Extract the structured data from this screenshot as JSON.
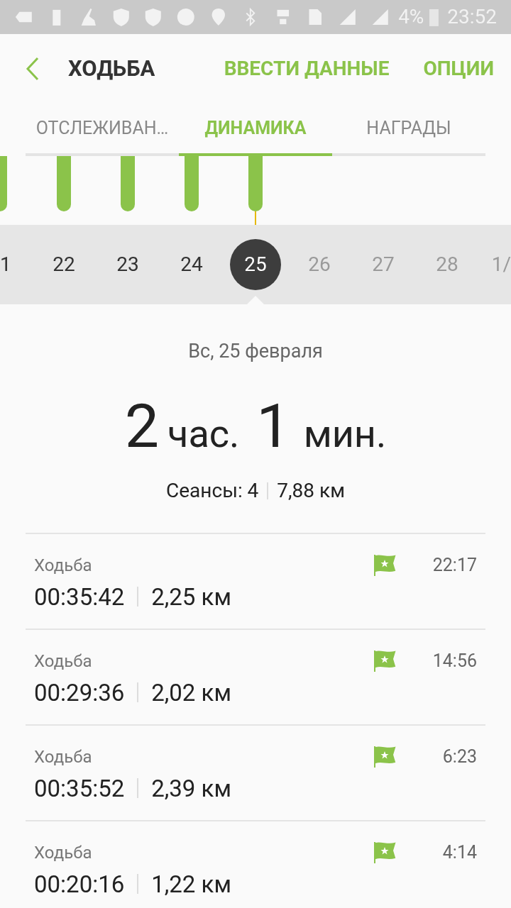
{
  "status_bar": {
    "battery": "4%",
    "time": "23:52"
  },
  "header": {
    "title": "ХОДЬБА",
    "actions": [
      "ВВЕСТИ ДАННЫЕ",
      "ОПЦИИ"
    ]
  },
  "tabs": [
    {
      "label": "ОТСЛЕЖИВАН…",
      "selected": false
    },
    {
      "label": "ДИНАМИКА",
      "selected": true
    },
    {
      "label": "НАГРАДЫ",
      "selected": false
    }
  ],
  "days": [
    {
      "label": "1",
      "selected": false,
      "disabled": false
    },
    {
      "label": "22",
      "selected": false,
      "disabled": false
    },
    {
      "label": "23",
      "selected": false,
      "disabled": false
    },
    {
      "label": "24",
      "selected": false,
      "disabled": false
    },
    {
      "label": "25",
      "selected": true,
      "disabled": false
    },
    {
      "label": "26",
      "selected": false,
      "disabled": true
    },
    {
      "label": "27",
      "selected": false,
      "disabled": true
    },
    {
      "label": "28",
      "selected": false,
      "disabled": true
    },
    {
      "label": "1/",
      "selected": false,
      "disabled": true
    }
  ],
  "summary": {
    "date": "Вс, 25 февраля",
    "hours": "2",
    "hours_unit": "час.",
    "minutes": "1",
    "minutes_unit": "мин.",
    "sessions": "Сеансы: 4",
    "distance": "7,88 км"
  },
  "sessions": [
    {
      "name": "Ходьба",
      "duration": "00:35:42",
      "distance": "2,25 км",
      "time": "22:17"
    },
    {
      "name": "Ходьба",
      "duration": "00:29:36",
      "distance": "2,02 км",
      "time": "14:56"
    },
    {
      "name": "Ходьба",
      "duration": "00:35:52",
      "distance": "2,39 км",
      "time": "6:23"
    },
    {
      "name": "Ходьба",
      "duration": "00:20:16",
      "distance": "1,22 км",
      "time": "4:14"
    }
  ]
}
